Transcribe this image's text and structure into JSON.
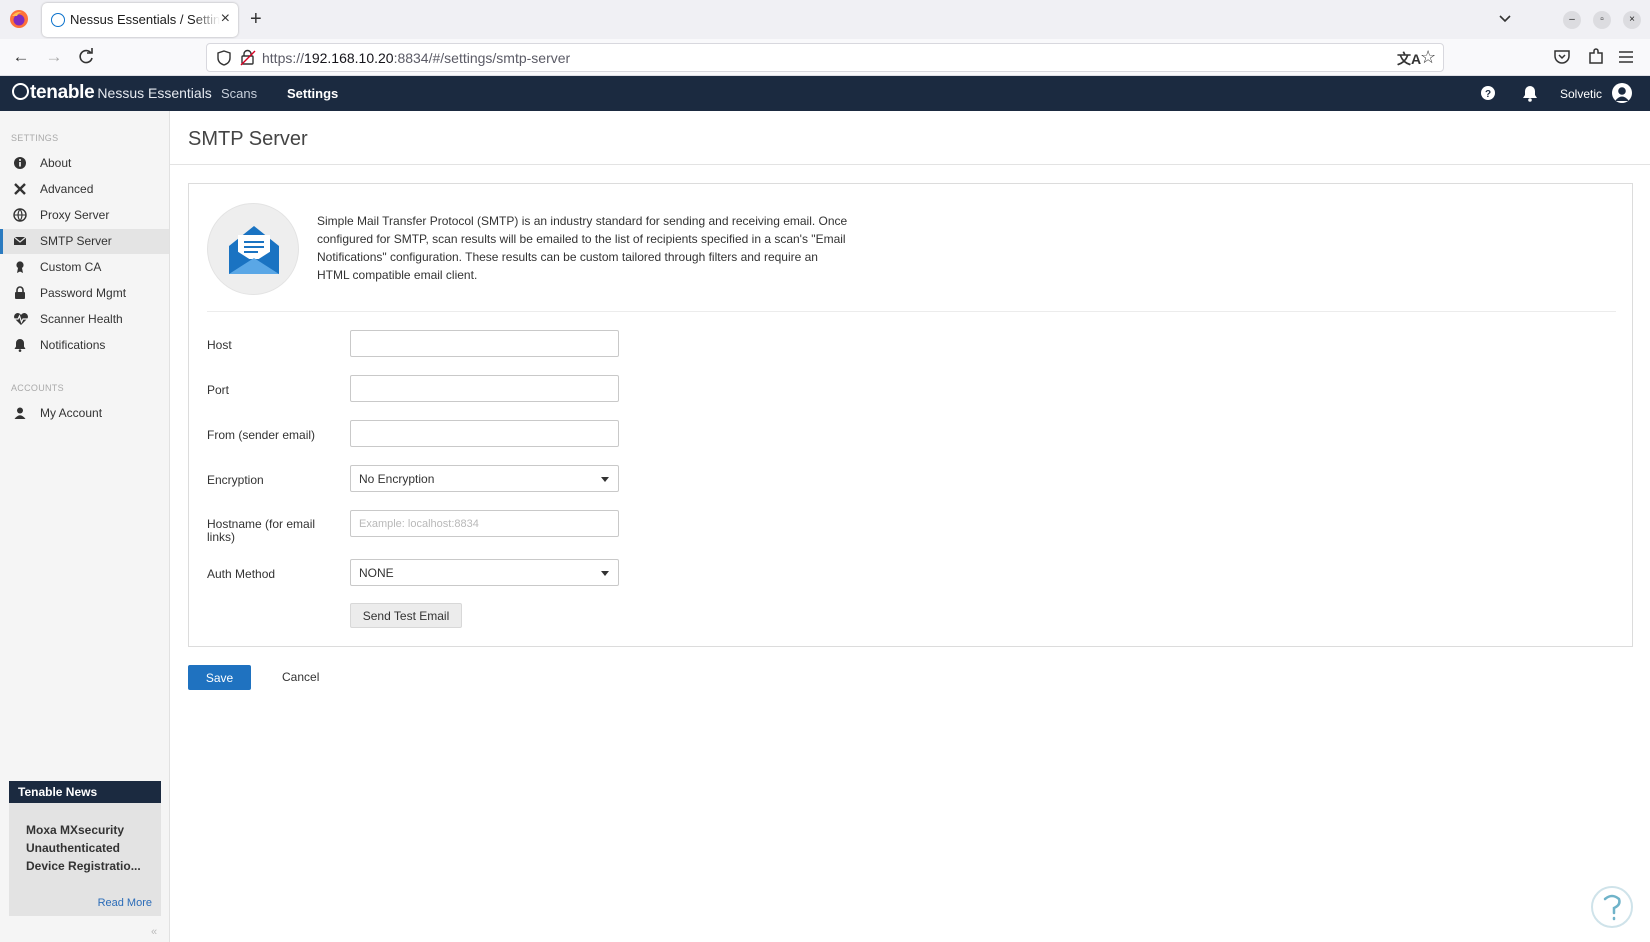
{
  "browser": {
    "tab_title": "Nessus Essentials / Settings / SMTP Server",
    "new_tab_glyph": "+",
    "close_glyph": "×",
    "url_scheme": "https://",
    "url_host": "192.168.10.20",
    "url_rest": ":8834/#/settings/smtp-server"
  },
  "app": {
    "brand_name": "tenable",
    "product_name": "Nessus Essentials",
    "nav": [
      {
        "label": "Scans"
      },
      {
        "label": "Settings"
      }
    ],
    "user_name": "Solvetic"
  },
  "sidebar": {
    "settings_heading": "SETTINGS",
    "settings_items": [
      {
        "label": "About",
        "icon": "info-icon"
      },
      {
        "label": "Advanced",
        "icon": "tools-icon"
      },
      {
        "label": "Proxy Server",
        "icon": "globe-icon"
      },
      {
        "label": "SMTP Server",
        "icon": "envelope-icon"
      },
      {
        "label": "Custom CA",
        "icon": "certificate-icon"
      },
      {
        "label": "Password Mgmt",
        "icon": "lock-icon"
      },
      {
        "label": "Scanner Health",
        "icon": "heartbeat-icon"
      },
      {
        "label": "Notifications",
        "icon": "bell-icon"
      }
    ],
    "accounts_heading": "ACCOUNTS",
    "accounts_items": [
      {
        "label": "My Account",
        "icon": "user-icon"
      }
    ],
    "news": {
      "heading": "Tenable News",
      "title": "Moxa MXsecurity Unauthenticated Device Registratio...",
      "read_more": "Read More"
    },
    "collapse_glyph": "«"
  },
  "page": {
    "title": "SMTP Server",
    "intro": "Simple Mail Transfer Protocol (SMTP) is an industry standard for sending and receiving email. Once configured for SMTP, scan results will be emailed to the list of recipients specified in a scan's \"Email Notifications\" configuration. These results can be custom tailored through filters and require an HTML compatible email client.",
    "form": {
      "host_label": "Host",
      "host_value": "",
      "port_label": "Port",
      "port_value": "",
      "from_label": "From (sender email)",
      "from_value": "",
      "encryption_label": "Encryption",
      "encryption_value": "No Encryption",
      "hostname_label": "Hostname (for email links)",
      "hostname_value": "",
      "hostname_placeholder": "Example: localhost:8834",
      "auth_label": "Auth Method",
      "auth_value": "NONE",
      "test_button": "Send Test Email"
    },
    "save_button": "Save",
    "cancel_button": "Cancel"
  },
  "colors": {
    "appbar": "#1b2a40",
    "primary": "#1f72c0",
    "mail_blue": "#1a73c2",
    "active_indicator": "#2b7bc0"
  }
}
